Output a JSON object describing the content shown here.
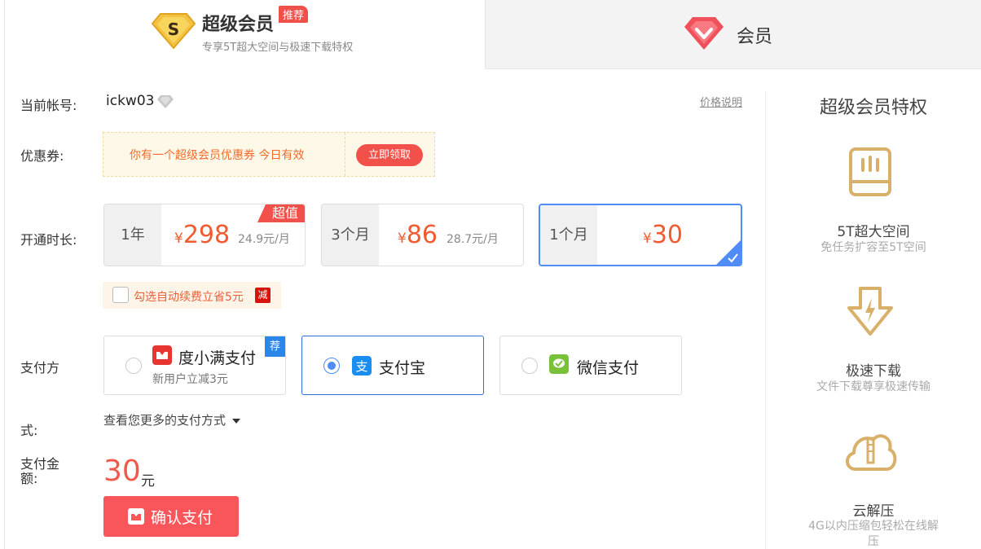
{
  "tabs": {
    "svip": {
      "title": "超级会员",
      "badge": "推荐",
      "subtitle": "专享5T超大空间与极速下载特权"
    },
    "vip": {
      "title": "会员"
    }
  },
  "account": {
    "label": "当前帐号:",
    "name": "ickw03",
    "price_link": "价格说明"
  },
  "coupon": {
    "label": "优惠券:",
    "text": "你有一个超级会员优惠券  今日有效",
    "button": "立即领取"
  },
  "duration": {
    "label": "开通时长:",
    "plans": [
      {
        "duration": "1年",
        "currency": "¥",
        "price": "298",
        "per_month": "24.9元/月",
        "tag": "超值",
        "selected": false
      },
      {
        "duration": "3个月",
        "currency": "¥",
        "price": "86",
        "per_month": "28.7元/月",
        "tag": "",
        "selected": false
      },
      {
        "duration": "1个月",
        "currency": "¥",
        "price": "30",
        "per_month": "",
        "tag": "",
        "selected": true
      }
    ]
  },
  "auto_renew": {
    "text": "勾选自动续费立省5元",
    "badge": "减",
    "checked": false
  },
  "payment": {
    "label_line1": "支付方",
    "label_line2": "式:",
    "methods": [
      {
        "name": "度小满支付",
        "sub": "新用户立减3元",
        "badge": "荐",
        "selected": false,
        "icon": "duxiaoman-icon"
      },
      {
        "name": "支付宝",
        "sub": "",
        "badge": "",
        "selected": true,
        "icon": "alipay-icon"
      },
      {
        "name": "微信支付",
        "sub": "",
        "badge": "",
        "selected": false,
        "icon": "wechat-pay-icon"
      }
    ],
    "more_label": "查看您更多的支付方式"
  },
  "amount": {
    "label_line1": "支付金",
    "label_line2": "额:",
    "value": "30",
    "unit": "元"
  },
  "confirm": {
    "label": "确认支付"
  },
  "sidebar": {
    "title": "超级会员特权",
    "features": [
      {
        "name": "5T超大空间",
        "desc": "免任务扩容至5T空间",
        "icon": "storage-icon"
      },
      {
        "name": "极速下载",
        "desc": "文件下载尊享极速传输",
        "icon": "fast-download-icon"
      },
      {
        "name": "云解压",
        "desc": "4G以内压缩包轻松在线解压",
        "icon": "cloud-unzip-icon"
      }
    ]
  },
  "colors": {
    "accent_red": "#f1504b",
    "price_orange": "#f25a30",
    "selected_blue": "#4f8cf5",
    "gold": "#d9b06a"
  }
}
